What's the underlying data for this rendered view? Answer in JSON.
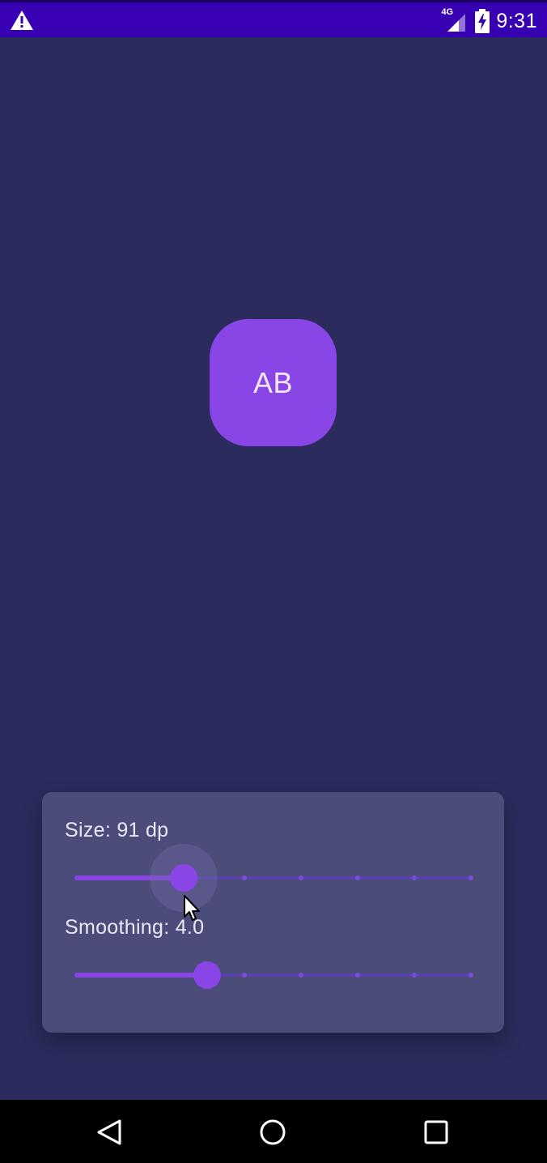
{
  "status_bar": {
    "time": "9:31",
    "network_label": "4G",
    "icons": [
      "warning-icon",
      "signal-icon",
      "battery-charging-icon"
    ],
    "color": "#3700b3"
  },
  "avatar": {
    "initials": "AB",
    "color": "#8a45e6"
  },
  "controls": {
    "size": {
      "label": "Size: 91 dp",
      "fraction": 0.275,
      "ticks": 7
    },
    "smoothing": {
      "label": "Smoothing: 4.0",
      "fraction": 0.335,
      "ticks": 7
    }
  },
  "nav_bar": {
    "icons": [
      "back-icon",
      "home-icon",
      "recents-icon"
    ]
  },
  "colors": {
    "background": "#2b2c5d",
    "card": "#4b4c7a",
    "accent": "#8a45e6"
  }
}
